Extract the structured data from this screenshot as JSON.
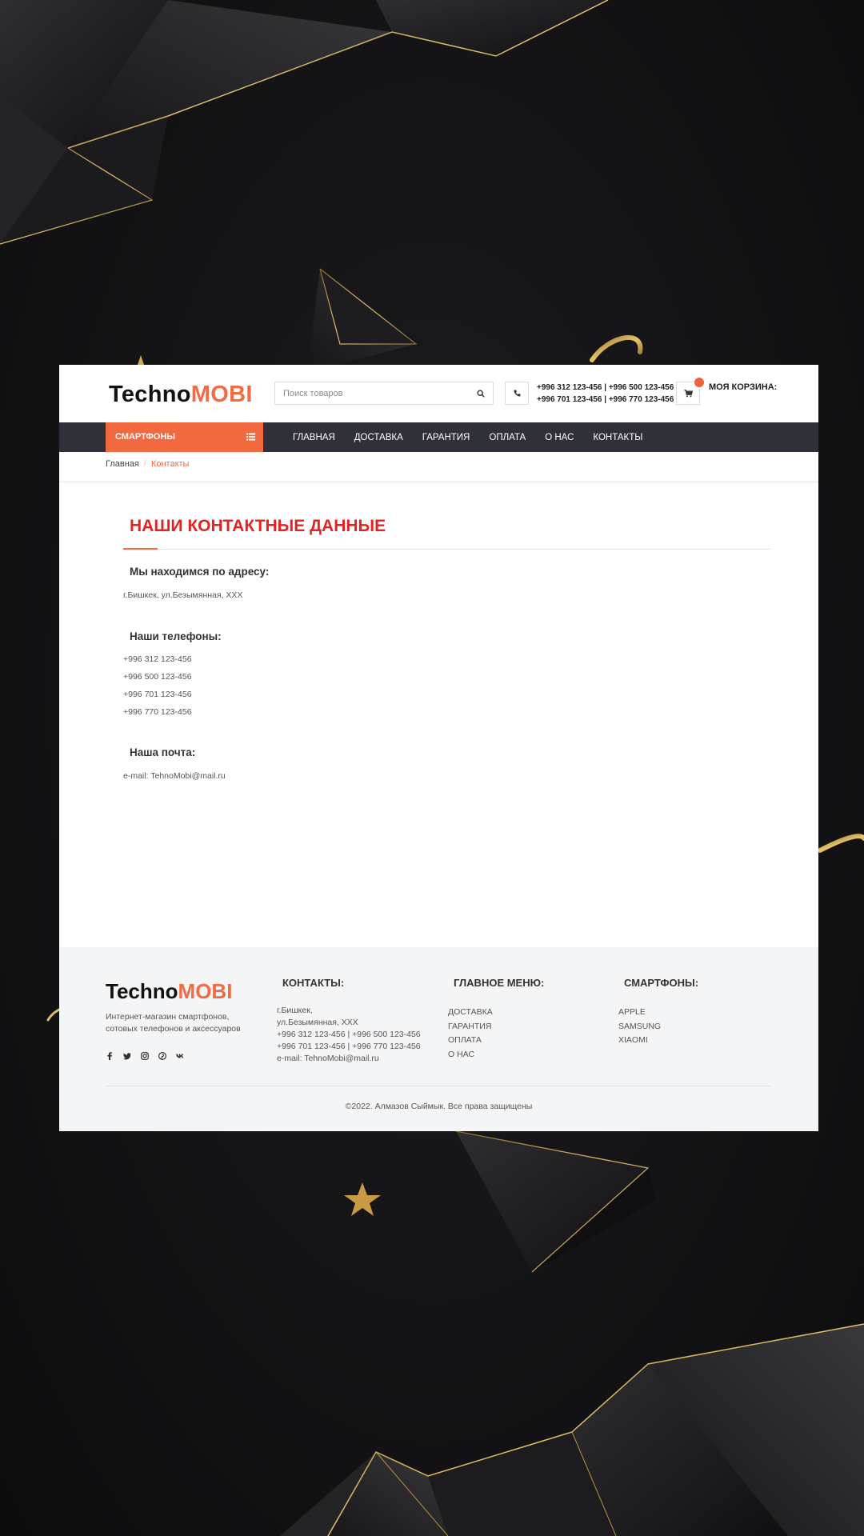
{
  "brand": {
    "part1": "Techno",
    "part2": "MOBI",
    "accent_color": "#f26b45"
  },
  "header": {
    "search": {
      "placeholder": "Поиск товаров",
      "value": ""
    },
    "phones": [
      "+996 312 123-456 | +996 500 123-456",
      "+996 701 123-456 | +996 770 123-456"
    ],
    "cart_label": "МОЯ КОРЗИНА:"
  },
  "nav": {
    "category_button": "СМАРТФОНЫ",
    "links": [
      "ГЛАВНАЯ",
      "ДОСТАВКА",
      "ГАРАНТИЯ",
      "ОПЛАТА",
      "О НАС",
      "КОНТАКТЫ"
    ]
  },
  "breadcrumb": {
    "home": "Главная",
    "separator": "/",
    "current": "Контакты"
  },
  "main": {
    "title": "НАШИ КОНТАКТНЫЕ ДАННЫЕ",
    "address": {
      "heading": "Мы находимся по адресу:",
      "text": "г.Бишкек, ул.Безымянная, XXX"
    },
    "phones": {
      "heading": "Наши телефоны:",
      "items": [
        "+996 312 123-456",
        "+996 500 123-456",
        "+996 701 123-456",
        "+996 770 123-456"
      ]
    },
    "email": {
      "heading": "Наша почта:",
      "text": "e-mail: TehnoMobi@mail.ru"
    }
  },
  "footer": {
    "description": "Интернет-магазин смартфонов, сотовых телефонов и аксессуаров",
    "socials": [
      "facebook-icon",
      "twitter-icon",
      "instagram-icon",
      "pinterest-icon",
      "vk-icon"
    ],
    "contacts": {
      "heading": "КОНТАКТЫ:",
      "lines": [
        "г.Бишкек,",
        "ул.Безымянная, XXX",
        "+996 312 123-456 | +996 500 123-456",
        "+996 701 123-456 | +996 770 123-456",
        "e-mail: TehnoMobi@mail.ru"
      ]
    },
    "menu": {
      "heading": "ГЛАВНОЕ МЕНЮ:",
      "items": [
        "ДОСТАВКА",
        "ГАРАНТИЯ",
        "ОПЛАТА",
        "О НАС"
      ]
    },
    "smartphones": {
      "heading": "СМАРТФОНЫ:",
      "items": [
        "APPLE",
        "SAMSUNG",
        "XIAOMI"
      ]
    },
    "copyright": "©2022. Алмазов Сыймык. Все права защищены"
  }
}
